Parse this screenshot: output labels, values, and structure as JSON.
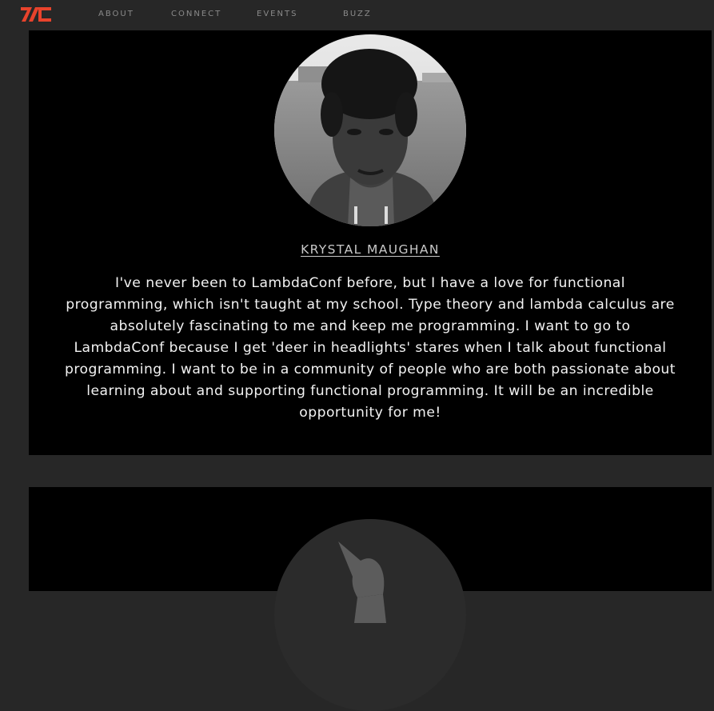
{
  "nav": {
    "logo_icon": "lambdaconf-logo-icon",
    "brand_color": "#e8432c",
    "items": [
      {
        "label": "ABOUT"
      },
      {
        "label": "CONNECT"
      },
      {
        "label": "EVENTS"
      },
      {
        "label": "BUZZ"
      }
    ]
  },
  "speakers": [
    {
      "name": "KRYSTAL MAUGHAN",
      "photo_icon": "speaker-photo",
      "bio": "I've never been to LambdaConf before, but I have a love for functional programming, which isn't taught at my school. Type theory and lambda calculus are absolutely fascinating to me and keep me programming. I want to go to LambdaConf because I get 'deer in headlights' stares when I talk about functional programming. I want to be in a community of people who are both passionate about learning about and supporting functional programming. It will be an incredible opportunity for me!"
    },
    {
      "photo_icon": "unicorn-icon"
    }
  ]
}
